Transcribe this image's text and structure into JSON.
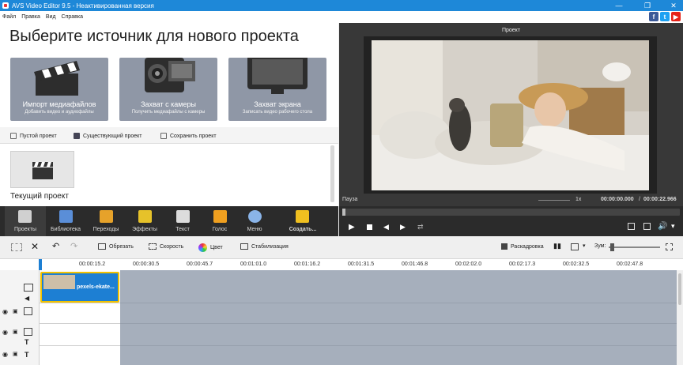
{
  "window": {
    "title": "AVS Video Editor 9.5 - Неактивированная версия"
  },
  "menu": [
    "Файл",
    "Правка",
    "Вид",
    "Справка"
  ],
  "start": {
    "heading": "Выберите источник для нового проекта",
    "tiles": [
      {
        "title": "Импорт медиафайлов",
        "subtitle": "Добавить видео и аудиофайлы"
      },
      {
        "title": "Захват с камеры",
        "subtitle": "Получить медиафайлы с камеры"
      },
      {
        "title": "Захват экрана",
        "subtitle": "Записать видео рабочего стола"
      }
    ],
    "project_links": [
      "Пустой проект",
      "Существующий проект",
      "Сохранить проект"
    ],
    "current_project": "Текущий проект"
  },
  "preview": {
    "title": "Проект",
    "status": "Пауза",
    "speed": "1x",
    "time_current": "00:00:00.000",
    "time_total": "00:00:22.966"
  },
  "toolbar": [
    {
      "label": "Проекты",
      "icon": "clapper-icon",
      "color": "#d0d0d0"
    },
    {
      "label": "Библиотека",
      "icon": "film-icon",
      "color": "#5a8ed8"
    },
    {
      "label": "Переходы",
      "icon": "transitions-icon",
      "color": "#e6a22a"
    },
    {
      "label": "Эффекты",
      "icon": "star-icon",
      "color": "#e6c22a"
    },
    {
      "label": "Текст",
      "icon": "text-icon",
      "color": "#dcdcdc"
    },
    {
      "label": "Голос",
      "icon": "microphone-icon",
      "color": "#f0a020"
    },
    {
      "label": "Меню",
      "icon": "disc-icon",
      "color": "#8ab4e8"
    },
    {
      "label": "Создать...",
      "icon": "create-icon",
      "color": "#f0c020"
    }
  ],
  "timeline_tools": {
    "cut": "Обрезать",
    "speed": "Скорость",
    "color": "Цвет",
    "stabilize": "Стабилизация",
    "storyboard": "Раскадровка",
    "zoom": "Зум:"
  },
  "ruler": [
    "00:00:15.2",
    "00:00:30.5",
    "00:00:45.7",
    "00:01:01.0",
    "00:01:16.2",
    "00:01:31.5",
    "00:01:46.8",
    "00:02:02.0",
    "00:02:17.3",
    "00:02:32.5",
    "00:02:47.8"
  ],
  "clip": {
    "name": "pexels-ekate..."
  },
  "colors": {
    "titlebar": "#1e88d8",
    "toolbar": "#2b2b2b",
    "clip": "#1d7fd3",
    "clip_border": "#f2c200",
    "timeline_bg": "#a6afbc"
  }
}
